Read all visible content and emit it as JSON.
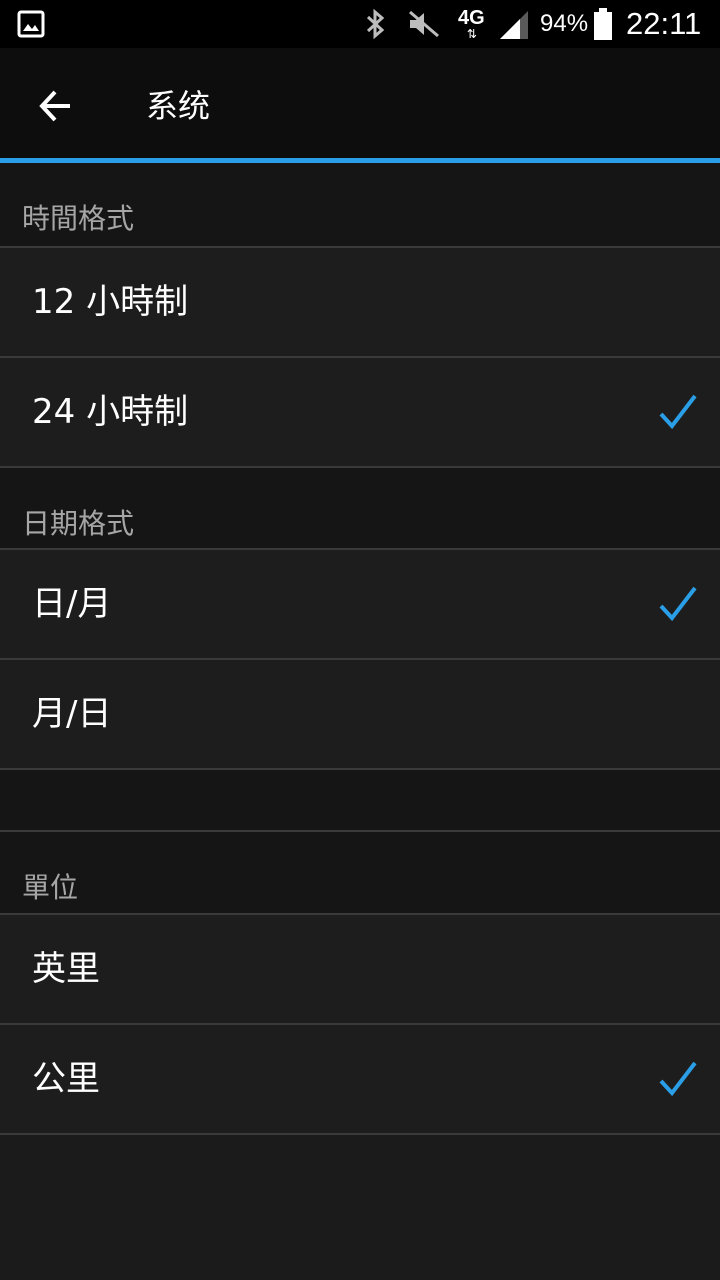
{
  "status_bar": {
    "battery": "94%",
    "time": "22:11",
    "network": "4G",
    "icons": [
      "gallery-icon",
      "bluetooth-icon",
      "mute-icon",
      "4g-icon",
      "signal-icon",
      "battery-icon"
    ]
  },
  "app_bar": {
    "title": "系统",
    "accent_color": "#2a9ee6"
  },
  "sections": {
    "time_format": {
      "header": "時間格式",
      "options": [
        {
          "label": "12 小時制",
          "checked": false
        },
        {
          "label": "24 小時制",
          "checked": true
        }
      ]
    },
    "date_format": {
      "header": "日期格式",
      "options": [
        {
          "label": "日/月",
          "checked": true
        },
        {
          "label": "月/日",
          "checked": false
        }
      ]
    },
    "units": {
      "header": "單位",
      "options": [
        {
          "label": "英里",
          "checked": false
        },
        {
          "label": "公里",
          "checked": true
        }
      ]
    }
  }
}
